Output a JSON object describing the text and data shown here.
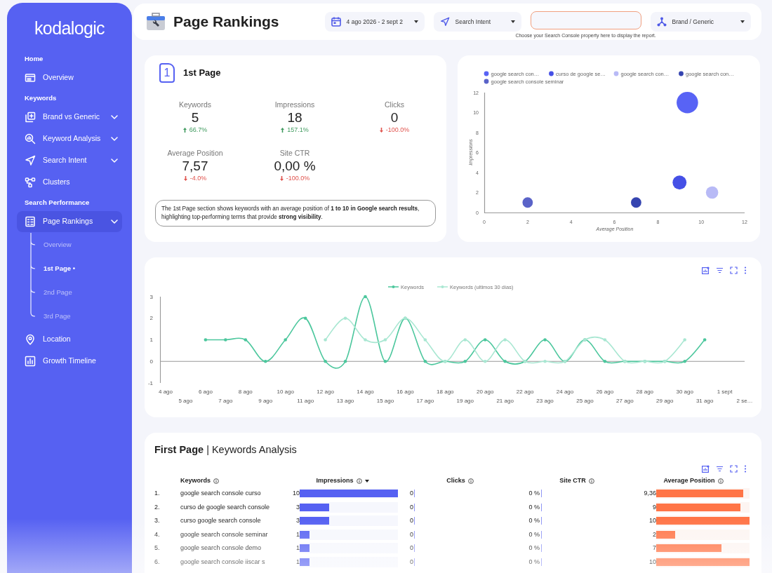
{
  "sidebar": {
    "logo": "kodalogic",
    "sections": [
      {
        "title": "Home",
        "items": [
          {
            "label": "Overview",
            "selected": false,
            "submenu": false
          }
        ]
      },
      {
        "title": "Keywords",
        "items": [
          {
            "label": "Brand vs Generic",
            "selected": false,
            "submenu": true
          },
          {
            "label": "Keyword Analysis",
            "selected": false,
            "submenu": true
          },
          {
            "label": "Search Intent",
            "selected": false,
            "submenu": true
          },
          {
            "label": "Clusters",
            "selected": false,
            "submenu": false
          }
        ]
      },
      {
        "title": "Search Performance",
        "items": [
          {
            "label": "Page Rankings",
            "selected": true,
            "submenu": true,
            "children": [
              {
                "label": "Overview",
                "selected": false
              },
              {
                "label": "1st Page •",
                "selected": true
              },
              {
                "label": "2nd Page",
                "selected": false
              },
              {
                "label": "3rd Page",
                "selected": false
              }
            ]
          },
          {
            "label": "Location",
            "selected": false,
            "submenu": false
          },
          {
            "label": "Growth Timeline",
            "selected": false,
            "submenu": false
          }
        ]
      }
    ]
  },
  "header": {
    "title": "Page Rankings",
    "date_range": "4 ago 2026 - 2 sept 2",
    "intent_filter": "Search Intent",
    "property_hint": "Choose your Search Console property here to display the report.",
    "brand_filter": "Brand / Generic"
  },
  "summary": {
    "badge": "1",
    "title": "1st Page",
    "metrics": [
      {
        "label": "Keywords",
        "value": "5",
        "change": "66.7%",
        "rising": true
      },
      {
        "label": "Impressions",
        "value": "18",
        "change": "157.1%",
        "rising": true
      },
      {
        "label": "Clicks",
        "value": "0",
        "change": "-100.0%",
        "rising": false
      },
      {
        "label": "Average Position",
        "value": "7,57",
        "change": "-4.0%",
        "rising": false
      },
      {
        "label": "Site CTR",
        "value": "0,00 %",
        "change": "-100.0%",
        "rising": false
      }
    ],
    "note": "The 1st Page section shows keywords with an average position of **1 to 10 in Google search results**, highlighting top-performing terms that provide **strong visibility**."
  },
  "bubble_chart": {
    "chart_data": {
      "type": "scatter",
      "legend": "top",
      "xlabel": "Average Position",
      "ylabel": "Impressions",
      "xlim": [
        0,
        12
      ],
      "ylim": [
        0,
        12
      ],
      "xticks": [
        0,
        2,
        4,
        6,
        8,
        10,
        12
      ],
      "yticks": [
        0,
        2,
        4,
        6,
        8,
        10,
        12
      ],
      "series": [
        {
          "name": "google search con…",
          "color": "#5863f5",
          "x": [
            9.36
          ],
          "values": [
            11
          ]
        },
        {
          "name": "curso de google se…",
          "color": "#4550e6",
          "x": [
            9
          ],
          "values": [
            3
          ]
        },
        {
          "name": "google search con…",
          "color": "#b8baf6",
          "x": [
            10.5
          ],
          "values": [
            2
          ]
        },
        {
          "name": "google search con…",
          "color": "#3544b0",
          "x": [
            7
          ],
          "values": [
            1
          ]
        },
        {
          "name": "google search console seminar",
          "color": "#5a63c8",
          "x": [
            2
          ],
          "values": [
            1
          ]
        }
      ]
    }
  },
  "trend_chart": {
    "chart_data": {
      "type": "line",
      "legend": "top",
      "categories": [
        "4 ago",
        "5 ago",
        "6 ago",
        "7 ago",
        "8 ago",
        "9 ago",
        "10 ago",
        "11 ago",
        "12 ago",
        "13 ago",
        "14 ago",
        "15 ago",
        "16 ago",
        "17 ago",
        "18 ago",
        "19 ago",
        "20 ago",
        "21 ago",
        "22 ago",
        "23 ago",
        "24 ago",
        "25 ago",
        "26 ago",
        "27 ago",
        "28 ago",
        "29 ago",
        "30 ago",
        "31 ago",
        "1 sept",
        "2 se…"
      ],
      "ylim": [
        -1,
        3
      ],
      "yticks": [
        -1,
        0,
        1,
        2,
        3
      ],
      "series": [
        {
          "name": "Keywords",
          "color": "#4cc79d",
          "values": [
            null,
            null,
            1,
            1,
            1,
            0,
            1,
            2,
            0,
            0,
            3,
            0,
            2,
            0,
            0,
            0,
            1,
            0,
            0,
            1,
            0,
            1,
            0,
            0,
            0,
            0,
            0,
            1,
            null,
            null
          ]
        },
        {
          "name": "Keywords (ultimos 30 días)",
          "color": "#a9e7d2",
          "values": [
            null,
            null,
            null,
            null,
            null,
            null,
            null,
            null,
            1,
            2,
            1,
            1,
            2,
            1,
            0,
            1,
            0,
            1,
            0,
            0,
            0,
            1,
            1,
            0,
            0,
            0,
            1,
            null,
            null,
            null
          ]
        }
      ]
    }
  },
  "keywords_table": {
    "title": "**First Page** | Keywords Analysis",
    "columns": [
      {
        "label": "Keywords",
        "sorted": false
      },
      {
        "label": "Impressions",
        "sorted": true
      },
      {
        "label": "Clicks",
        "sorted": false
      },
      {
        "label": "Site CTR",
        "sorted": false
      },
      {
        "label": "Average Position",
        "sorted": false
      }
    ],
    "rows": [
      {
        "index": "1.",
        "keyword": "google search console curso",
        "impressions": {
          "value": "10",
          "level": 1
        },
        "clicks": "0",
        "ctr": "0 %",
        "position": {
          "value": "9,36",
          "level": 0.936
        }
      },
      {
        "index": "2.",
        "keyword": "curso de google search console",
        "impressions": {
          "value": "3",
          "level": 0.3
        },
        "clicks": "0",
        "ctr": "0 %",
        "position": {
          "value": "9",
          "level": 0.9
        }
      },
      {
        "index": "3.",
        "keyword": "curso google search console",
        "impressions": {
          "value": "3",
          "level": 0.3
        },
        "clicks": "0",
        "ctr": "0 %",
        "position": {
          "value": "10",
          "level": 1
        }
      },
      {
        "index": "4.",
        "keyword": "google search console seminar",
        "impressions": {
          "value": "1",
          "level": 0.1
        },
        "clicks": "0",
        "ctr": "0 %",
        "position": {
          "value": "2",
          "level": 0.2
        }
      },
      {
        "index": "5.",
        "keyword": "google search console demo",
        "impressions": {
          "value": "1",
          "level": 0.1
        },
        "clicks": "0",
        "ctr": "0 %",
        "position": {
          "value": "7",
          "level": 0.7
        }
      },
      {
        "index": "6.",
        "keyword": "google search console iiscar s",
        "impressions": {
          "value": "1",
          "level": 0.1
        },
        "clicks": "0",
        "ctr": "0 %",
        "position": {
          "value": "10",
          "level": 1
        }
      }
    ]
  }
}
